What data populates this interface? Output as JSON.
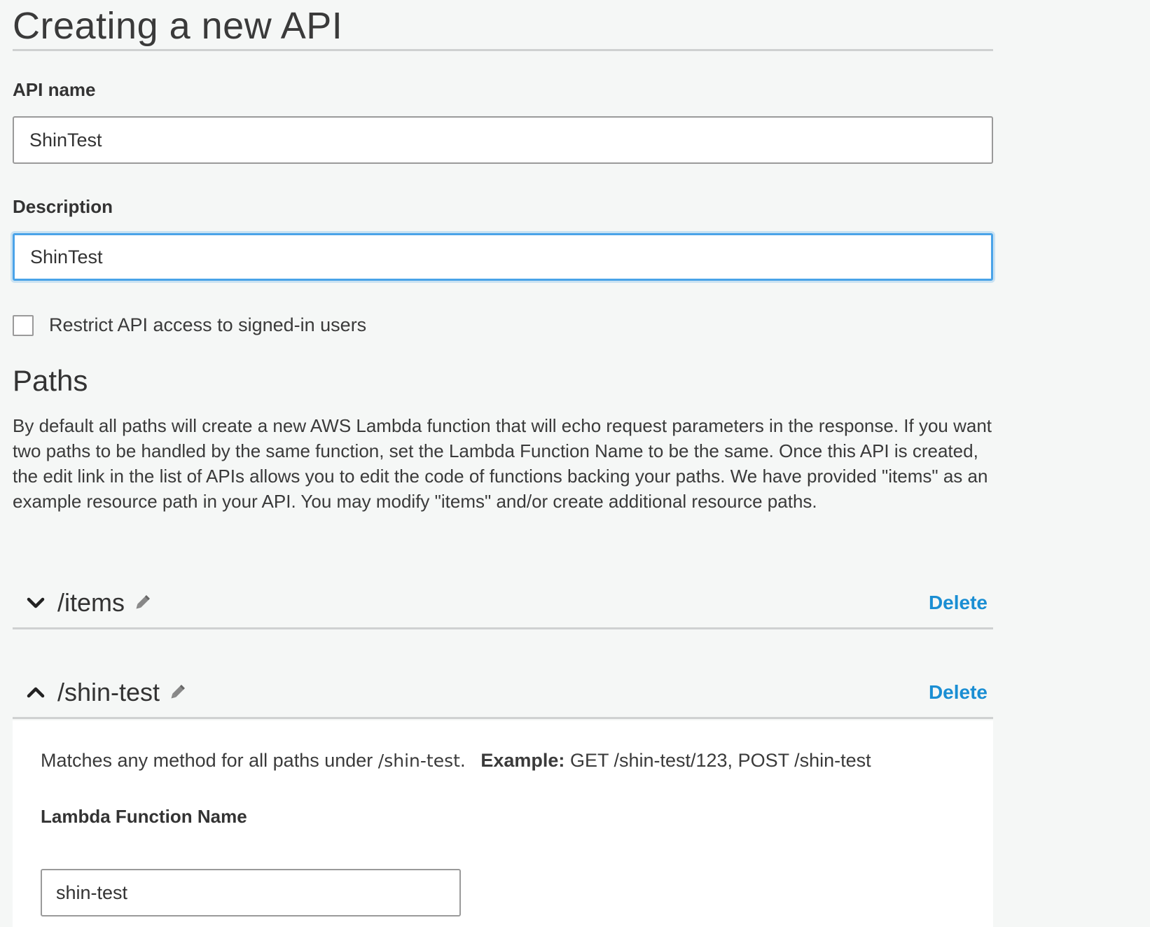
{
  "page": {
    "title": "Creating a new API"
  },
  "form": {
    "api_name_label": "API name",
    "api_name_value": "ShinTest",
    "description_label": "Description",
    "description_value": "ShinTest",
    "restrict_label": "Restrict API access to signed-in users",
    "restrict_checked": false
  },
  "paths_section": {
    "title": "Paths",
    "description": "By default all paths will create a new AWS Lambda function that will echo request parameters in the response. If you want two paths to be handled by the same function, set the Lambda Function Name to be the same. Once this API is created, the edit link in the list of APIs allows you to edit the code of functions backing your paths. We have provided \"items\" as an example resource path in your API. You may modify \"items\" and/or create additional resource paths."
  },
  "paths": [
    {
      "name": "/items",
      "expanded": false,
      "chevron_icon": "chevron-down-icon",
      "edit_icon": "pencil-icon",
      "delete_label": "Delete"
    },
    {
      "name": "/shin-test",
      "expanded": true,
      "chevron_icon": "chevron-up-icon",
      "edit_icon": "pencil-icon",
      "delete_label": "Delete",
      "match_prefix": "Matches any method for all paths under",
      "match_path": "/shin-test.",
      "example_label": "Example:",
      "example_value": "GET /shin-test/123, POST /shin-test",
      "lambda_label": "Lambda Function Name",
      "lambda_value": "shin-test"
    }
  ],
  "colors": {
    "background": "#f5f7f6",
    "link": "#1a8ed3",
    "focus_border": "#4aa3e8",
    "rule": "#cfd1d1"
  }
}
